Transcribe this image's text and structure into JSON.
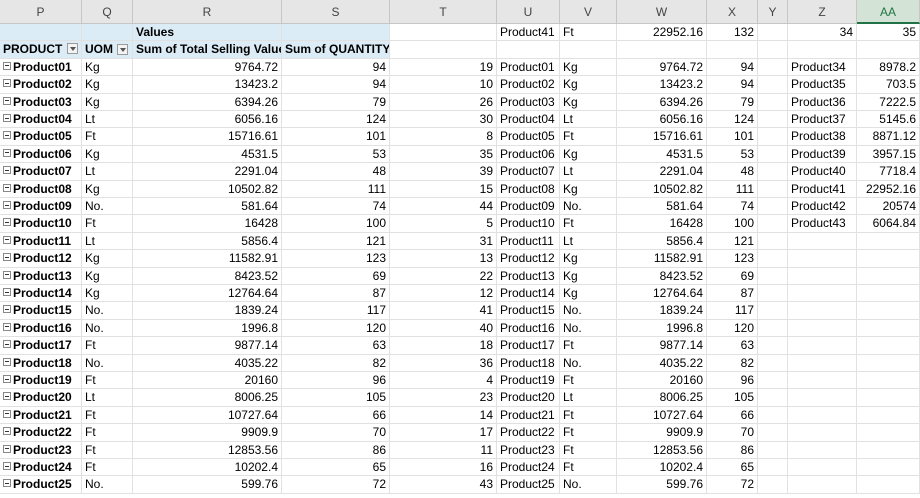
{
  "columns": [
    "P",
    "Q",
    "R",
    "S",
    "T",
    "U",
    "V",
    "W",
    "X",
    "Y",
    "Z",
    "AA"
  ],
  "selected_column": "AA",
  "pivot": {
    "values_header": "Values",
    "row_label_header": "PRODUCT",
    "uom_header": "UOM",
    "value1_header": "Sum of Total Selling Value",
    "value2_header": "Sum of QUANTITY",
    "rows": [
      {
        "product": "Product01",
        "uom": "Kg",
        "value": "9764.72",
        "qty": "94"
      },
      {
        "product": "Product02",
        "uom": "Kg",
        "value": "13423.2",
        "qty": "94"
      },
      {
        "product": "Product03",
        "uom": "Kg",
        "value": "6394.26",
        "qty": "79"
      },
      {
        "product": "Product04",
        "uom": "Lt",
        "value": "6056.16",
        "qty": "124"
      },
      {
        "product": "Product05",
        "uom": "Ft",
        "value": "15716.61",
        "qty": "101"
      },
      {
        "product": "Product06",
        "uom": "Kg",
        "value": "4531.5",
        "qty": "53"
      },
      {
        "product": "Product07",
        "uom": "Lt",
        "value": "2291.04",
        "qty": "48"
      },
      {
        "product": "Product08",
        "uom": "Kg",
        "value": "10502.82",
        "qty": "111"
      },
      {
        "product": "Product09",
        "uom": "No.",
        "value": "581.64",
        "qty": "74"
      },
      {
        "product": "Product10",
        "uom": "Ft",
        "value": "16428",
        "qty": "100"
      },
      {
        "product": "Product11",
        "uom": "Lt",
        "value": "5856.4",
        "qty": "121"
      },
      {
        "product": "Product12",
        "uom": "Kg",
        "value": "11582.91",
        "qty": "123"
      },
      {
        "product": "Product13",
        "uom": "Kg",
        "value": "8423.52",
        "qty": "69"
      },
      {
        "product": "Product14",
        "uom": "Kg",
        "value": "12764.64",
        "qty": "87"
      },
      {
        "product": "Product15",
        "uom": "No.",
        "value": "1839.24",
        "qty": "117"
      },
      {
        "product": "Product16",
        "uom": "No.",
        "value": "1996.8",
        "qty": "120"
      },
      {
        "product": "Product17",
        "uom": "Ft",
        "value": "9877.14",
        "qty": "63"
      },
      {
        "product": "Product18",
        "uom": "No.",
        "value": "4035.22",
        "qty": "82"
      },
      {
        "product": "Product19",
        "uom": "Ft",
        "value": "20160",
        "qty": "96"
      },
      {
        "product": "Product20",
        "uom": "Lt",
        "value": "8006.25",
        "qty": "105"
      },
      {
        "product": "Product21",
        "uom": "Ft",
        "value": "10727.64",
        "qty": "66"
      },
      {
        "product": "Product22",
        "uom": "Ft",
        "value": "9909.9",
        "qty": "70"
      },
      {
        "product": "Product23",
        "uom": "Ft",
        "value": "12853.56",
        "qty": "86"
      },
      {
        "product": "Product24",
        "uom": "Ft",
        "value": "10202.4",
        "qty": "65"
      },
      {
        "product": "Product25",
        "uom": "No.",
        "value": "599.76",
        "qty": "72"
      }
    ]
  },
  "list_top": {
    "product": "Product41",
    "uom": "Ft",
    "value": "22952.16",
    "qty": "132"
  },
  "list_rows": [
    {
      "idx": "19",
      "product": "Product01",
      "uom": "Kg",
      "value": "9764.72",
      "qty": "94"
    },
    {
      "idx": "10",
      "product": "Product02",
      "uom": "Kg",
      "value": "13423.2",
      "qty": "94"
    },
    {
      "idx": "26",
      "product": "Product03",
      "uom": "Kg",
      "value": "6394.26",
      "qty": "79"
    },
    {
      "idx": "30",
      "product": "Product04",
      "uom": "Lt",
      "value": "6056.16",
      "qty": "124"
    },
    {
      "idx": "8",
      "product": "Product05",
      "uom": "Ft",
      "value": "15716.61",
      "qty": "101"
    },
    {
      "idx": "35",
      "product": "Product06",
      "uom": "Kg",
      "value": "4531.5",
      "qty": "53"
    },
    {
      "idx": "39",
      "product": "Product07",
      "uom": "Lt",
      "value": "2291.04",
      "qty": "48"
    },
    {
      "idx": "15",
      "product": "Product08",
      "uom": "Kg",
      "value": "10502.82",
      "qty": "111"
    },
    {
      "idx": "44",
      "product": "Product09",
      "uom": "No.",
      "value": "581.64",
      "qty": "74"
    },
    {
      "idx": "5",
      "product": "Product10",
      "uom": "Ft",
      "value": "16428",
      "qty": "100"
    },
    {
      "idx": "31",
      "product": "Product11",
      "uom": "Lt",
      "value": "5856.4",
      "qty": "121"
    },
    {
      "idx": "13",
      "product": "Product12",
      "uom": "Kg",
      "value": "11582.91",
      "qty": "123"
    },
    {
      "idx": "22",
      "product": "Product13",
      "uom": "Kg",
      "value": "8423.52",
      "qty": "69"
    },
    {
      "idx": "12",
      "product": "Product14",
      "uom": "Kg",
      "value": "12764.64",
      "qty": "87"
    },
    {
      "idx": "41",
      "product": "Product15",
      "uom": "No.",
      "value": "1839.24",
      "qty": "117"
    },
    {
      "idx": "40",
      "product": "Product16",
      "uom": "No.",
      "value": "1996.8",
      "qty": "120"
    },
    {
      "idx": "18",
      "product": "Product17",
      "uom": "Ft",
      "value": "9877.14",
      "qty": "63"
    },
    {
      "idx": "36",
      "product": "Product18",
      "uom": "No.",
      "value": "4035.22",
      "qty": "82"
    },
    {
      "idx": "4",
      "product": "Product19",
      "uom": "Ft",
      "value": "20160",
      "qty": "96"
    },
    {
      "idx": "23",
      "product": "Product20",
      "uom": "Lt",
      "value": "8006.25",
      "qty": "105"
    },
    {
      "idx": "14",
      "product": "Product21",
      "uom": "Ft",
      "value": "10727.64",
      "qty": "66"
    },
    {
      "idx": "17",
      "product": "Product22",
      "uom": "Ft",
      "value": "9909.9",
      "qty": "70"
    },
    {
      "idx": "11",
      "product": "Product23",
      "uom": "Ft",
      "value": "12853.56",
      "qty": "86"
    },
    {
      "idx": "16",
      "product": "Product24",
      "uom": "Ft",
      "value": "10202.4",
      "qty": "65"
    },
    {
      "idx": "43",
      "product": "Product25",
      "uom": "No.",
      "value": "599.76",
      "qty": "72"
    }
  ],
  "side_top": {
    "z": "34",
    "aa": "35"
  },
  "side_rows": [
    {
      "product": "Product34",
      "value": "8978.2"
    },
    {
      "product": "Product35",
      "value": "703.5"
    },
    {
      "product": "Product36",
      "value": "7222.5"
    },
    {
      "product": "Product37",
      "value": "5145.6"
    },
    {
      "product": "Product38",
      "value": "8871.12"
    },
    {
      "product": "Product39",
      "value": "3957.15"
    },
    {
      "product": "Product40",
      "value": "7718.4"
    },
    {
      "product": "Product41",
      "value": "22952.16"
    },
    {
      "product": "Product42",
      "value": "20574"
    },
    {
      "product": "Product43",
      "value": "6064.84"
    }
  ],
  "colors": {
    "header_bg": "#e6e6e6",
    "pivot_header_bg": "#dcecf7",
    "selected_header": "#217346",
    "gridline": "#e1e1e1"
  }
}
